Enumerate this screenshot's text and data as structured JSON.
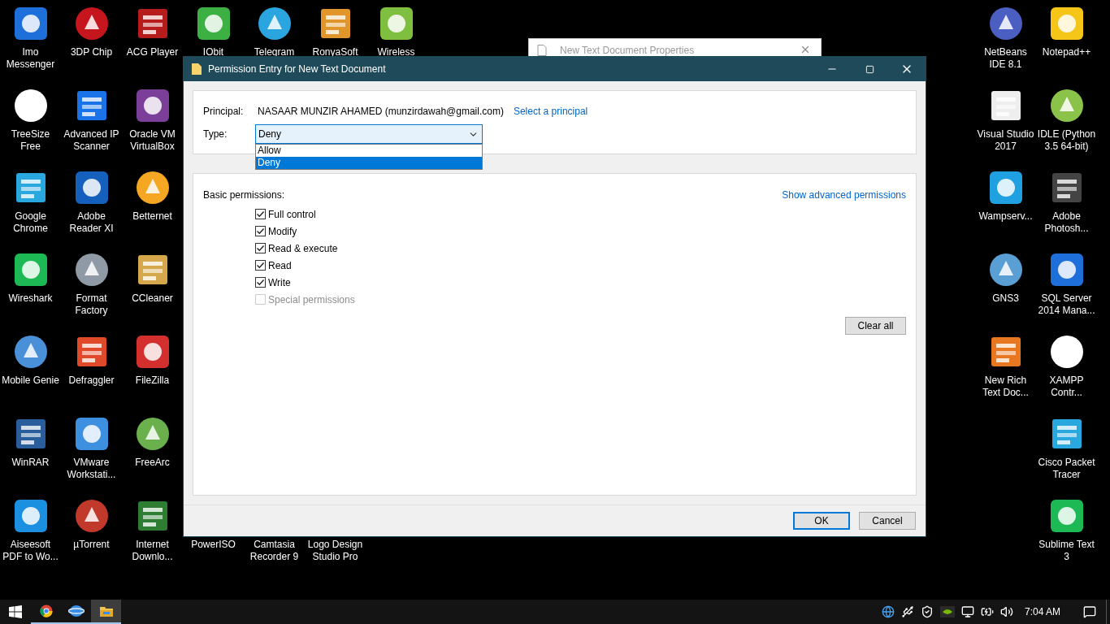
{
  "desktop": {
    "left_columns": [
      [
        {
          "label": "Imo Messenger"
        },
        {
          "label": "TreeSize Free"
        },
        {
          "label": "Google Chrome"
        },
        {
          "label": "Wireshark"
        },
        {
          "label": "Mobile Genie"
        },
        {
          "label": "WinRAR"
        },
        {
          "label": "Aiseesoft PDF to Wo..."
        }
      ],
      [
        {
          "label": "3DP Chip"
        },
        {
          "label": "Advanced IP Scanner"
        },
        {
          "label": "Adobe Reader XI"
        },
        {
          "label": "Format Factory"
        },
        {
          "label": "Defraggler"
        },
        {
          "label": "VMware Workstati..."
        },
        {
          "label": "µTorrent"
        }
      ],
      [
        {
          "label": "ACG Player"
        },
        {
          "label": "Oracle VM VirtualBox"
        },
        {
          "label": "Betternet"
        },
        {
          "label": "CCleaner"
        },
        {
          "label": "FileZilla"
        },
        {
          "label": "FreeArc"
        },
        {
          "label": "Internet Downlo..."
        }
      ]
    ],
    "top_row": [
      {
        "label": "IObit"
      },
      {
        "label": "Telegram"
      },
      {
        "label": "RonyaSoft"
      },
      {
        "label": "Wireless"
      }
    ],
    "bottom_row": [
      {
        "label": "PowerISO"
      },
      {
        "label": "Camtasia Recorder 9"
      },
      {
        "label": "Logo Design Studio Pro"
      }
    ],
    "right_columns": [
      [
        {
          "label": "NetBeans IDE 8.1"
        },
        {
          "label": "Visual Studio 2017"
        },
        {
          "label": "Wampserv..."
        },
        {
          "label": "GNS3"
        },
        {
          "label": "New Rich Text Doc..."
        }
      ],
      [
        {
          "label": "Notepad++"
        },
        {
          "label": "IDLE (Python 3.5 64-bit)"
        },
        {
          "label": "Adobe Photosh..."
        },
        {
          "label": "SQL Server 2014 Mana..."
        },
        {
          "label": "XAMPP Contr..."
        },
        {
          "label": "Cisco Packet Tracer"
        },
        {
          "label": "Sublime Text 3"
        }
      ]
    ]
  },
  "background_window": {
    "title": "New Text Document Properties"
  },
  "dialog": {
    "title": "Permission Entry for New Text Document",
    "principal": {
      "label": "Principal:",
      "value": "NASAAR MUNZIR AHAMED (munzirdawah@gmail.com)",
      "link": "Select a principal"
    },
    "type": {
      "label": "Type:",
      "value": "Deny",
      "expanded": true,
      "options": [
        {
          "label": "Allow",
          "selected": false
        },
        {
          "label": "Deny",
          "selected": true
        }
      ]
    },
    "permissions": {
      "heading": "Basic permissions:",
      "link": "Show advanced permissions",
      "clear_button": "Clear all",
      "items": [
        {
          "label": "Full control",
          "checked": true,
          "disabled": false
        },
        {
          "label": "Modify",
          "checked": true,
          "disabled": false
        },
        {
          "label": "Read & execute",
          "checked": true,
          "disabled": false
        },
        {
          "label": "Read",
          "checked": true,
          "disabled": false
        },
        {
          "label": "Write",
          "checked": true,
          "disabled": false
        },
        {
          "label": "Special permissions",
          "checked": false,
          "disabled": true
        }
      ]
    },
    "buttons": [
      {
        "label": "OK",
        "default": true
      },
      {
        "label": "Cancel",
        "default": false
      }
    ]
  },
  "taskbar": {
    "apps": [
      {
        "kind": "browser",
        "selected": false
      },
      {
        "kind": "network",
        "selected": false
      },
      {
        "kind": "folder",
        "selected": true
      }
    ],
    "clock": "7:04 AM"
  }
}
